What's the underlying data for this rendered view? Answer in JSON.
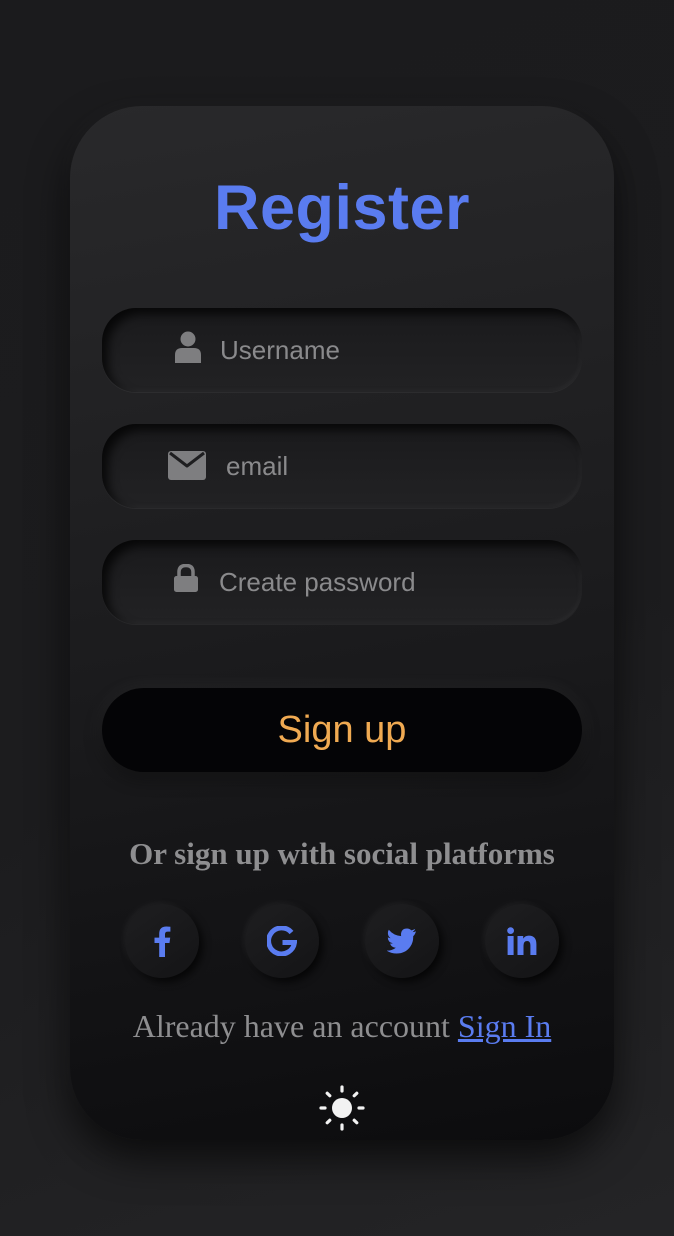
{
  "form": {
    "title": "Register",
    "username_placeholder": "Username",
    "email_placeholder": "email",
    "password_placeholder": "Create password",
    "signup_label": "Sign up"
  },
  "social": {
    "heading": "Or sign up with social platforms",
    "icons": [
      "facebook-icon",
      "google-icon",
      "twitter-icon",
      "linkedin-icon"
    ]
  },
  "footer": {
    "prompt": "Already have an account ",
    "signin_link": "Sign In"
  },
  "theme": {
    "icon": "sun-icon"
  },
  "colors": {
    "accent_blue": "#5a7cf0",
    "button_text_orange": "#f0aa52",
    "muted_text": "#8a8a8c"
  }
}
